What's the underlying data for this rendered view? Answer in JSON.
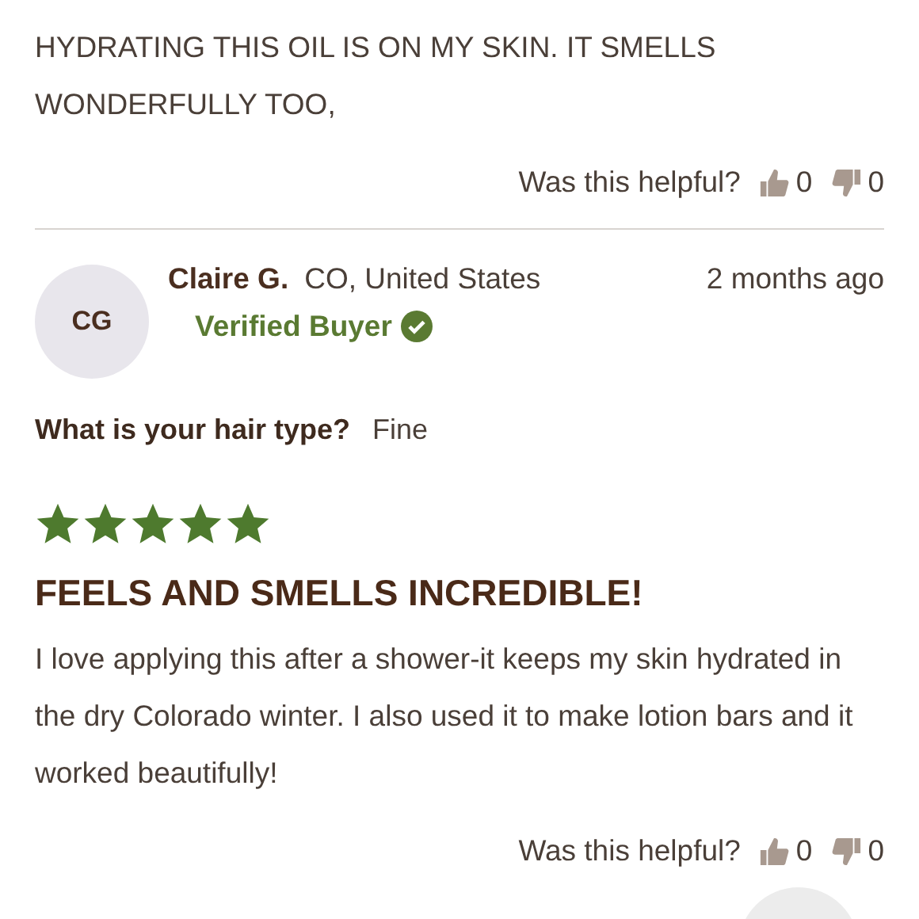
{
  "previous_review": {
    "body": "HYDRATING THIS OIL IS ON MY SKIN. IT SMELLS WONDERFULLY TOO,",
    "helpful": {
      "label": "Was this helpful?",
      "up_count": "0",
      "down_count": "0"
    }
  },
  "review": {
    "avatar_initials": "CG",
    "name": "Claire G.",
    "location": "CO, United States",
    "date": "2 months ago",
    "verified_label": "Verified Buyer",
    "question": "What is your hair type?",
    "answer": "Fine",
    "stars": 5,
    "title": "FEELS AND SMELLS INCREDIBLE!",
    "body": "I love applying this after a shower-it keeps my skin hydrated in the dry Colorado winter. I also used it to make lotion bars and it worked beautifully!",
    "helpful": {
      "label": "Was this helpful?",
      "up_count": "0",
      "down_count": "0"
    }
  }
}
